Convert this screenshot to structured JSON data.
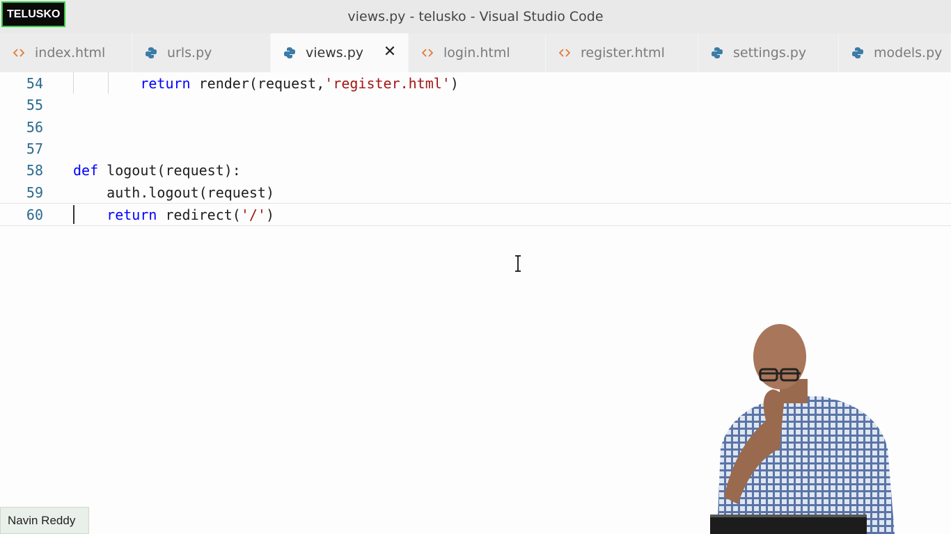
{
  "window": {
    "title": "views.py - telusko - Visual Studio Code",
    "logo": "TELUSKO"
  },
  "tabs": [
    {
      "label": "index.html",
      "icon": "html-icon",
      "active": false
    },
    {
      "label": "urls.py",
      "icon": "python-icon",
      "active": false
    },
    {
      "label": "views.py",
      "icon": "python-icon",
      "active": true
    },
    {
      "label": "login.html",
      "icon": "html-icon",
      "active": false
    },
    {
      "label": "register.html",
      "icon": "html-icon",
      "active": false
    },
    {
      "label": "settings.py",
      "icon": "python-icon",
      "active": false
    },
    {
      "label": "models.py",
      "icon": "python-icon",
      "active": false
    }
  ],
  "tab_close_glyph": "✕",
  "editor": {
    "lines": [
      {
        "number": "54",
        "indent": "        ",
        "kw": "return",
        "text": " render(request,",
        "str": "'register.html'",
        "tail": ")"
      },
      {
        "number": "55",
        "indent": "",
        "kw": "",
        "text": "",
        "str": "",
        "tail": ""
      },
      {
        "number": "56",
        "indent": "",
        "kw": "",
        "text": "",
        "str": "",
        "tail": ""
      },
      {
        "number": "57",
        "indent": "",
        "kw": "",
        "text": "",
        "str": "",
        "tail": ""
      },
      {
        "number": "58",
        "indent": "",
        "kw": "def",
        "text": " logout(request):",
        "str": "",
        "tail": ""
      },
      {
        "number": "59",
        "indent": "    ",
        "kw": "",
        "text": "auth.logout(request)",
        "str": "",
        "tail": ""
      },
      {
        "number": "60",
        "indent": "    ",
        "kw": "return",
        "text": " redirect(",
        "str": "'/'",
        "tail": ")"
      }
    ],
    "current_line": "60"
  },
  "overlay": {
    "presenter_name": "Navin Reddy"
  },
  "colors": {
    "keyword": "#0000ff",
    "string": "#a31515",
    "line_number": "#2b6a8e",
    "logo_border": "#2ecc40"
  }
}
